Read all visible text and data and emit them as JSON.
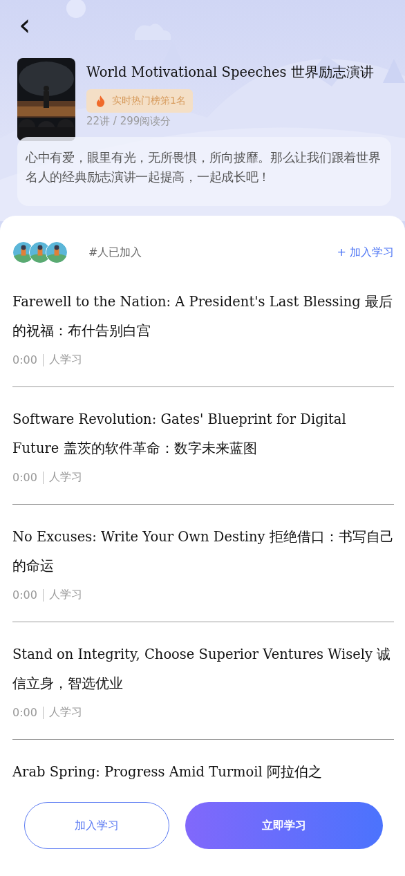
{
  "header": {
    "back": "‹",
    "title": "World Motivational Speeches 世界励志演讲",
    "badge": "实时热门榜第1名",
    "stats": "22讲 / 299阅读分",
    "description": "心中有爱，眼里有光，无所畏惧，所向披靡。那么让我们跟着世界名人的经典励志演讲一起提高，一起成长吧！"
  },
  "members": {
    "count_text": "#人已加入",
    "join_link": "+ 加入学习"
  },
  "lessons": [
    {
      "title": "Farewell to the Nation: A President's Last Blessing 最后的祝福：布什告别白宫",
      "duration": "0:00",
      "learners": "人学习"
    },
    {
      "title": "Software Revolution: Gates' Blueprint for Digital Future 盖茨的软件革命：数字未来蓝图",
      "duration": "0:00",
      "learners": "人学习"
    },
    {
      "title": "No Excuses: Write Your Own Destiny 拒绝借口：书写自己的命运",
      "duration": "0:00",
      "learners": "人学习"
    },
    {
      "title": "Stand on Integrity, Choose Superior Ventures Wisely 诚信立身，智选优业",
      "duration": "0:00",
      "learners": "人学习"
    },
    {
      "title": "Arab Spring: Progress Amid Turmoil 阿拉伯之"
    }
  ],
  "buttons": [
    {
      "label": "加入学习",
      "kind": "outline"
    },
    {
      "label": "立即学习",
      "kind": "primary"
    }
  ]
}
